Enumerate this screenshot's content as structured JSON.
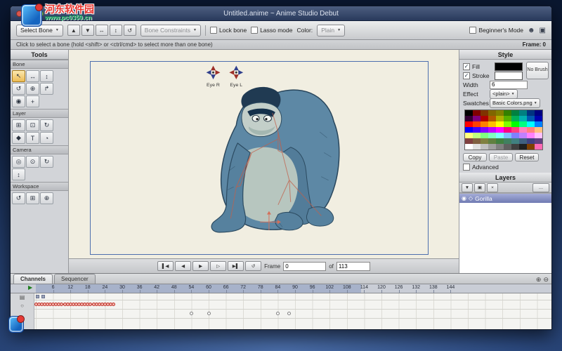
{
  "window_title": "Untitled.anime ~ Anime Studio Debut",
  "watermark": {
    "name": "河东软件园",
    "url": "www.pc0359.cn"
  },
  "icons": {
    "dropdown_arrow": "▼",
    "check": "✓",
    "user": "☻",
    "display": "▣",
    "zoom_in": "⊕",
    "zoom_out": "⊖",
    "layer_channel": "▤",
    "bone_channel": "○",
    "ellipsis": "…"
  },
  "toolbar": {
    "tool_selector": "Select Bone",
    "mini_buttons": [
      {
        "name": "option-up-button",
        "glyph": "▲"
      },
      {
        "name": "option-down-button",
        "glyph": "▼"
      },
      {
        "name": "option-translate-button",
        "glyph": "↔"
      },
      {
        "name": "option-scale-button",
        "glyph": "↕"
      },
      {
        "name": "option-rotate-button",
        "glyph": "↺"
      }
    ],
    "bone_constraints": "Bone Constraints",
    "lock_bone": "Lock bone",
    "lasso_mode": "Lasso mode",
    "color_label": "Color:",
    "color_value": "Plain",
    "beginners_mode": "Beginner's Mode"
  },
  "hint_bar": {
    "hint": "Click to select a bone (hold <shift> or <ctrl/cmd> to select more than one bone)",
    "frame_label": "Frame: 0"
  },
  "tools_panel": {
    "title": "Tools",
    "sections": [
      {
        "label": "Bone",
        "tools": [
          {
            "name": "select-bone",
            "glyph": "↖",
            "selected": true
          },
          {
            "name": "translate-bone",
            "glyph": "↔"
          },
          {
            "name": "scale-bone",
            "glyph": "↕"
          },
          {
            "name": "rotate-bone",
            "glyph": "↺"
          },
          {
            "name": "add-bone",
            "glyph": "⊕"
          },
          {
            "name": "reparent-bone",
            "glyph": "↱"
          },
          {
            "name": "bone-strength",
            "glyph": "◉"
          },
          {
            "name": "manipulate-bones",
            "glyph": "+"
          }
        ]
      },
      {
        "label": "Layer",
        "tools": [
          {
            "name": "translate-layer",
            "glyph": "⊞"
          },
          {
            "name": "scale-layer",
            "glyph": "⊡"
          },
          {
            "name": "rotate-layer",
            "glyph": "↻"
          },
          {
            "name": "follow-path",
            "glyph": "◆"
          },
          {
            "name": "insert-text",
            "glyph": "T"
          },
          {
            "name": "eyedropper",
            "glyph": "◔"
          }
        ]
      },
      {
        "label": "Camera",
        "tools": [
          {
            "name": "track-camera",
            "glyph": "◎"
          },
          {
            "name": "zoom-camera",
            "glyph": "⊙"
          },
          {
            "name": "roll-camera",
            "glyph": "↻"
          },
          {
            "name": "pan-tilt-camera",
            "glyph": "↕"
          }
        ]
      },
      {
        "label": "Workspace",
        "tools": [
          {
            "name": "rotate-workspace",
            "glyph": "↺"
          },
          {
            "name": "pan-workspace",
            "glyph": "⊞"
          },
          {
            "name": "zoom-workspace",
            "glyph": "⊕"
          }
        ]
      }
    ]
  },
  "canvas": {
    "widgets": [
      {
        "label": "Eye R"
      },
      {
        "label": "Eye L"
      }
    ]
  },
  "style_panel": {
    "title": "Style",
    "fill_label": "Fill",
    "stroke_label": "Stroke",
    "fill_color": "#000000",
    "stroke_color": "#ffffff",
    "no_brush_label": "No Brush",
    "width_label": "Width",
    "width_value": "6",
    "effect_label": "Effect",
    "effect_value": "<plain>",
    "swatches_label": "Swatches",
    "swatches_value": "Basic Colors.png",
    "copy_label": "Copy",
    "paste_label": "Paste",
    "reset_label": "Reset",
    "advanced_label": "Advanced",
    "palette": [
      [
        "#000000",
        "#800000",
        "#803300",
        "#806600",
        "#808000",
        "#338000",
        "#008040",
        "#008080",
        "#003380",
        "#000080"
      ],
      [
        "#330033",
        "#800080",
        "#b00000",
        "#b05800",
        "#b0b000",
        "#58b000",
        "#00b058",
        "#00b0b0",
        "#0058b0",
        "#0000b0"
      ],
      [
        "#ff0000",
        "#ff4000",
        "#ff8000",
        "#ffbf00",
        "#ffff00",
        "#80ff00",
        "#00ff00",
        "#00ff80",
        "#00ffff",
        "#0080ff"
      ],
      [
        "#0000ff",
        "#4000ff",
        "#8000ff",
        "#bf00ff",
        "#ff00ff",
        "#ff0080",
        "#ff4080",
        "#ff80c0",
        "#ff8080",
        "#ffbf80"
      ],
      [
        "#ffff80",
        "#bfff80",
        "#80ff80",
        "#80ffbf",
        "#80ffff",
        "#80bfff",
        "#8080ff",
        "#bf80ff",
        "#ff80ff",
        "#ffbfff"
      ],
      [
        "#804040",
        "#806040",
        "#808040",
        "#608040",
        "#408040",
        "#408060",
        "#408080",
        "#406080",
        "#404080",
        "#604080"
      ],
      [
        "#ffffff",
        "#e0e0e0",
        "#c0c0c0",
        "#a0a0a0",
        "#808080",
        "#606060",
        "#404040",
        "#202020",
        "#804000",
        "#ff69b4"
      ]
    ]
  },
  "layers_panel": {
    "title": "Layers",
    "toolbar": [
      {
        "name": "new-layer-button",
        "glyph": "▼"
      },
      {
        "name": "duplicate-layer-button",
        "glyph": "▣"
      },
      {
        "name": "delete-layer-button",
        "glyph": "×"
      },
      {
        "name": "more-button",
        "glyph": "…",
        "wide": true
      }
    ],
    "visibility_glyph": "◉",
    "type_glyph": "◇",
    "layers": [
      {
        "name": "Gorilla",
        "selected": true
      }
    ]
  },
  "playback": {
    "buttons": [
      {
        "name": "jump-start-button",
        "glyph": "▌◀"
      },
      {
        "name": "step-back-button",
        "glyph": "◀"
      },
      {
        "name": "play-button",
        "glyph": "▶"
      },
      {
        "name": "step-forward-button",
        "glyph": "▷"
      },
      {
        "name": "jump-end-button",
        "glyph": "▶▌"
      },
      {
        "name": "loop-button",
        "glyph": "↺"
      }
    ],
    "frame_label": "Frame",
    "frame_value": "0",
    "of_label": "of",
    "end_value": "113"
  },
  "timeline": {
    "tabs": [
      {
        "label": "Channels",
        "active": true
      },
      {
        "label": "Sequencer",
        "active": false
      }
    ],
    "ruler_labels": [
      6,
      12,
      18,
      24,
      30,
      36,
      42,
      48,
      54,
      60,
      66,
      72,
      78,
      84,
      90,
      96,
      102,
      108,
      114,
      120,
      126,
      132,
      138,
      144
    ],
    "shaded_end_frame": 113,
    "chain": {
      "start": 0,
      "end": 27
    },
    "singles": [
      54,
      60,
      84,
      88
    ],
    "channel_markers": [
      0,
      2
    ]
  }
}
